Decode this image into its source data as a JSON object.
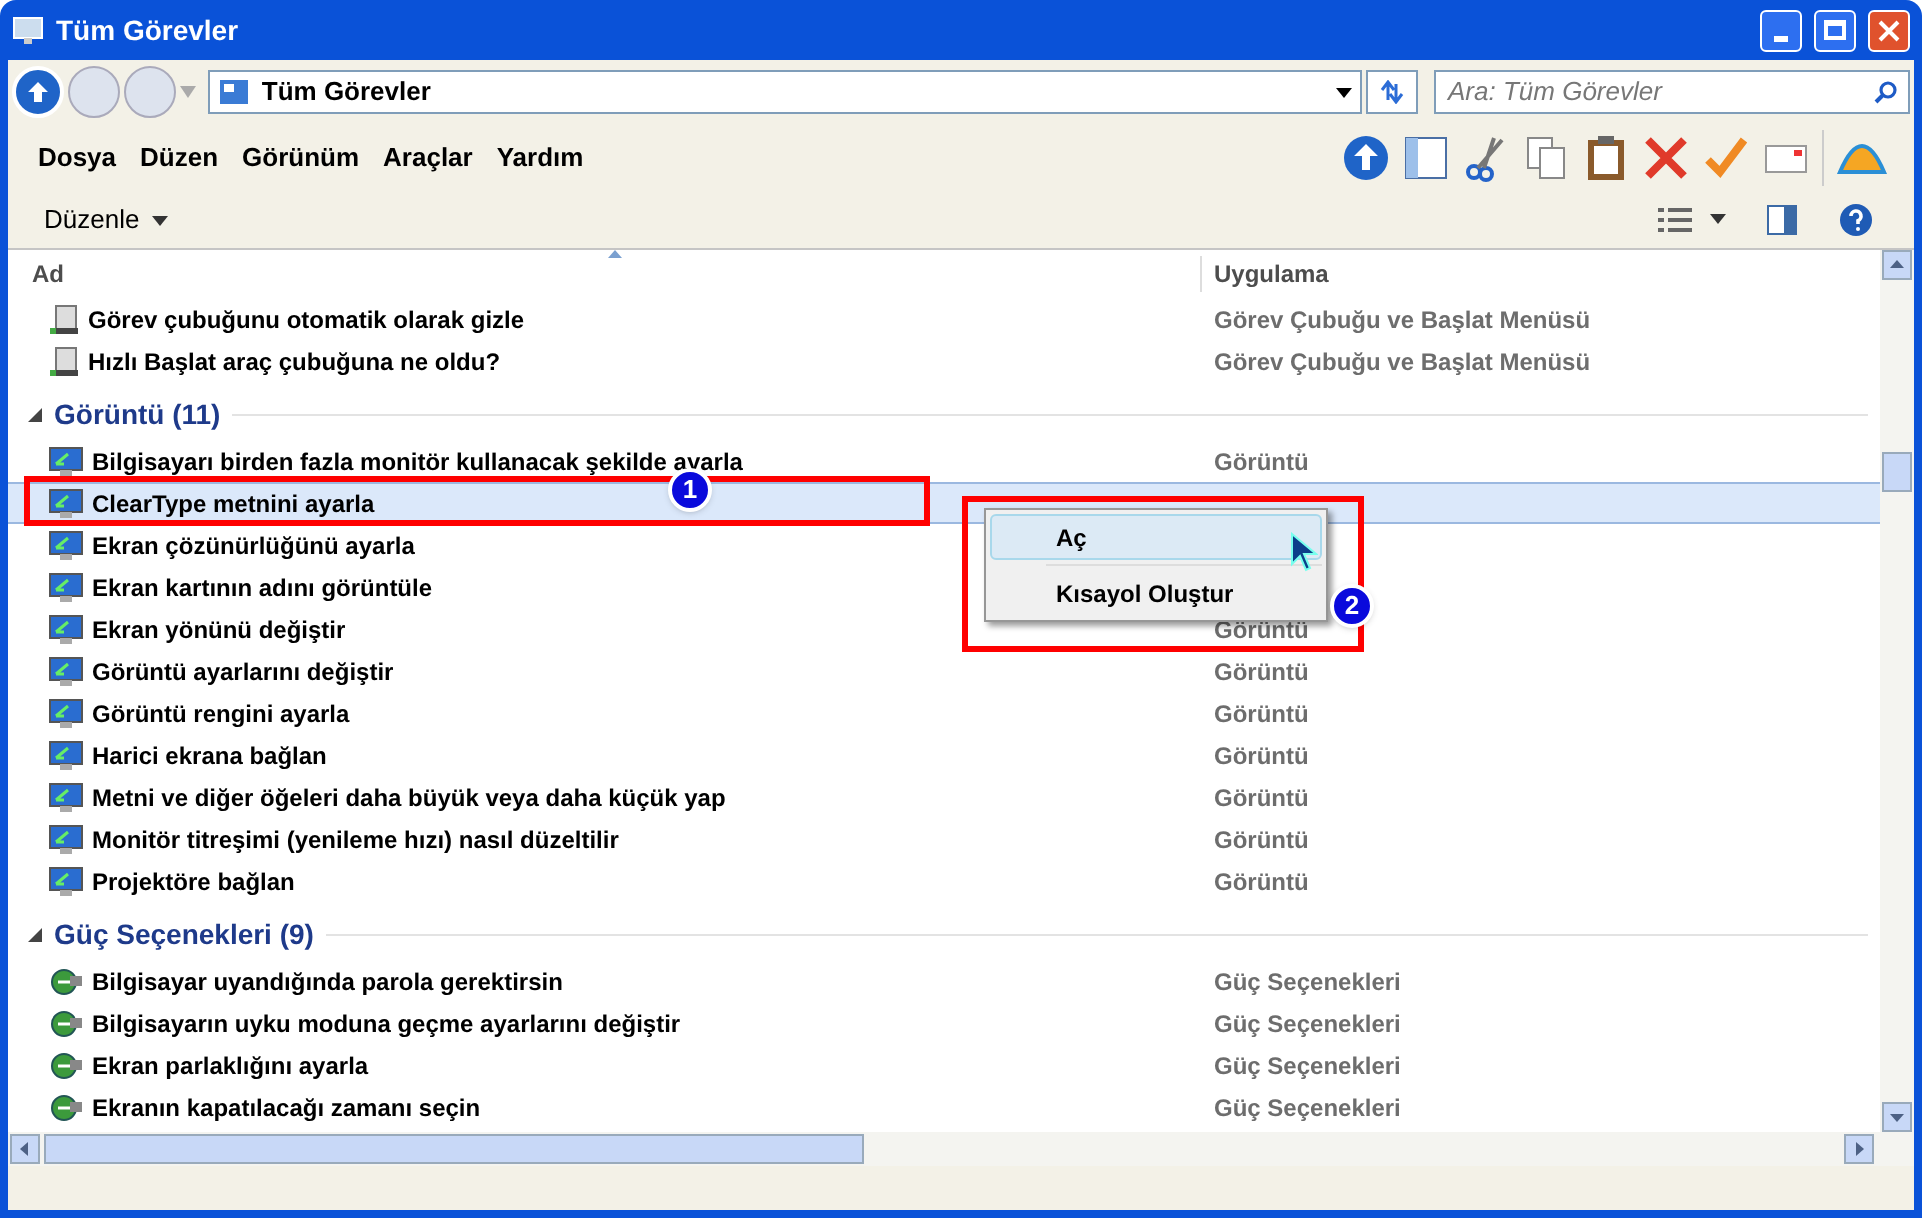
{
  "window": {
    "title": "Tüm Görevler"
  },
  "address": {
    "location": "Tüm Görevler"
  },
  "search": {
    "placeholder": "Ara: Tüm Görevler"
  },
  "menu_bar": [
    "Dosya",
    "Düzen",
    "Görünüm",
    "Araçlar",
    "Yardım"
  ],
  "organize": {
    "label": "Düzenle"
  },
  "columns": [
    "Ad",
    "Uygulama"
  ],
  "groups": [
    {
      "items": [
        {
          "name": "Görev çubuğunu otomatik olarak gizle",
          "app": "Görev Çubuğu ve Başlat Menüsü",
          "kind": "taskbar",
          "selected": false
        },
        {
          "name": "Hızlı Başlat araç çubuğuna ne oldu?",
          "app": "Görev Çubuğu ve Başlat Menüsü",
          "kind": "taskbar",
          "selected": false
        }
      ]
    },
    {
      "title": "Görüntü (11)",
      "expanded": true,
      "items": [
        {
          "name": "Bilgisayarı birden fazla monitör kullanacak şekilde ayarla",
          "app": "Görüntü",
          "kind": "display",
          "selected": false
        },
        {
          "name": "ClearType metnini ayarla",
          "kind": "display",
          "selected": true
        },
        {
          "name": "Ekran çözünürlüğünü ayarla",
          "kind": "display",
          "selected": false
        },
        {
          "name": "Ekran kartının adını görüntüle",
          "kind": "display",
          "selected": false
        },
        {
          "name": "Ekran yönünü değiştir",
          "app": "Görüntü",
          "kind": "display",
          "selected": false
        },
        {
          "name": "Görüntü ayarlarını değiştir",
          "app": "Görüntü",
          "kind": "display",
          "selected": false
        },
        {
          "name": "Görüntü rengini ayarla",
          "app": "Görüntü",
          "kind": "display",
          "selected": false
        },
        {
          "name": "Harici ekrana bağlan",
          "app": "Görüntü",
          "kind": "display",
          "selected": false
        },
        {
          "name": "Metni ve diğer öğeleri daha büyük veya daha küçük yap",
          "app": "Görüntü",
          "kind": "display",
          "selected": false
        },
        {
          "name": "Monitör titreşimi (yenileme hızı) nasıl düzeltilir",
          "app": "Görüntü",
          "kind": "display",
          "selected": false
        },
        {
          "name": "Projektöre bağlan",
          "app": "Görüntü",
          "kind": "display",
          "selected": false
        }
      ]
    },
    {
      "title": "Güç Seçenekleri (9)",
      "expanded": true,
      "items": [
        {
          "name": "Bilgisayar uyandığında parola gerektirsin",
          "app": "Güç Seçenekleri",
          "kind": "power",
          "selected": false
        },
        {
          "name": "Bilgisayarın uyku moduna geçme ayarlarını değiştir",
          "app": "Güç Seçenekleri",
          "kind": "power",
          "selected": false
        },
        {
          "name": "Ekran parlaklığını ayarla",
          "app": "Güç Seçenekleri",
          "kind": "power",
          "selected": false
        },
        {
          "name": "Ekranın kapatılacağı zamanı seçin",
          "app": "Güç Seçenekleri",
          "kind": "power",
          "selected": false
        }
      ]
    }
  ],
  "context_menu": [
    {
      "label": "Aç",
      "selected": true
    },
    {
      "label": "Kısayol Oluştur",
      "selected": false
    }
  ],
  "callouts": [
    "1",
    "2"
  ]
}
